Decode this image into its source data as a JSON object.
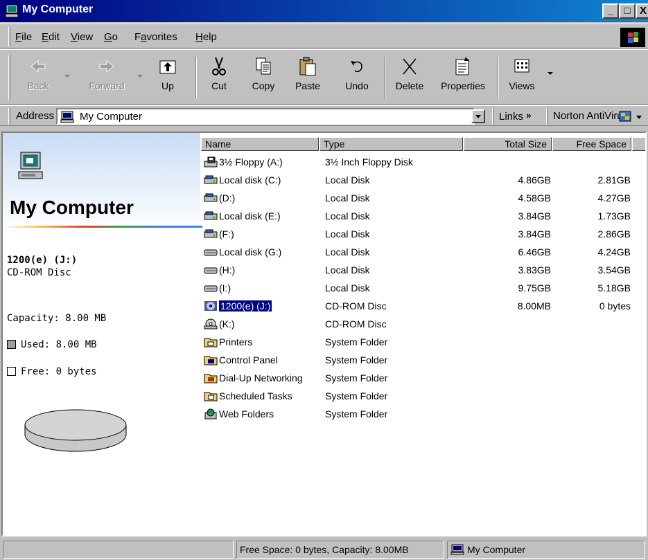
{
  "window": {
    "title": "My Computer",
    "controls": {
      "minimize": "_",
      "maximize": "□",
      "close": "X"
    }
  },
  "menu": [
    "File",
    "Edit",
    "View",
    "Go",
    "Favorites",
    "Help"
  ],
  "menu_accel": [
    "F",
    "E",
    "V",
    "G",
    "a",
    "H"
  ],
  "toolbar": {
    "buttons": [
      {
        "id": "back",
        "label": "Back",
        "icon": "back-arrow-icon",
        "enabled": false,
        "dropdown": true
      },
      {
        "id": "forward",
        "label": "Forward",
        "icon": "forward-arrow-icon",
        "enabled": false,
        "dropdown": true
      },
      {
        "id": "up",
        "label": "Up",
        "icon": "up-folder-icon",
        "enabled": true
      },
      {
        "id": "cut",
        "label": "Cut",
        "icon": "scissors-icon",
        "enabled": true
      },
      {
        "id": "copy",
        "label": "Copy",
        "icon": "copy-icon",
        "enabled": true
      },
      {
        "id": "paste",
        "label": "Paste",
        "icon": "paste-icon",
        "enabled": true
      },
      {
        "id": "undo",
        "label": "Undo",
        "icon": "undo-icon",
        "enabled": true
      },
      {
        "id": "delete",
        "label": "Delete",
        "icon": "delete-x-icon",
        "enabled": true
      },
      {
        "id": "properties",
        "label": "Properties",
        "icon": "properties-icon",
        "enabled": true
      },
      {
        "id": "views",
        "label": "Views",
        "icon": "views-icon",
        "enabled": true,
        "dropdown": true
      }
    ]
  },
  "address": {
    "label": "Address",
    "value": "My Computer",
    "links_label": "Links",
    "links_chevron": "»",
    "norton_label": "Norton AntiVirus"
  },
  "left_pane": {
    "title": "My Computer",
    "drive_name": "1200(e) (J:)",
    "drive_type": "CD-ROM Disc",
    "capacity": "Capacity: 8.00 MB",
    "used": "Used: 8.00 MB",
    "free": "Free: 0 bytes",
    "used_fraction": 1.0
  },
  "list": {
    "columns": [
      "Name",
      "Type",
      "Total Size",
      "Free Space"
    ],
    "rows": [
      {
        "name": "3½ Floppy (A:)",
        "type": "3½ Inch Floppy Disk",
        "total": "",
        "free": "",
        "icon": "floppy-drive-icon"
      },
      {
        "name": "Local disk (C:)",
        "type": "Local Disk",
        "total": "4.86GB",
        "free": "2.81GB",
        "icon": "hard-drive-icon"
      },
      {
        "name": "(D:)",
        "type": "Local Disk",
        "total": "4.58GB",
        "free": "4.27GB",
        "icon": "hard-drive-icon"
      },
      {
        "name": "Local disk (E:)",
        "type": "Local Disk",
        "total": "3.84GB",
        "free": "1.73GB",
        "icon": "hard-drive-icon"
      },
      {
        "name": "(F:)",
        "type": "Local Disk",
        "total": "3.84GB",
        "free": "2.86GB",
        "icon": "hard-drive-icon"
      },
      {
        "name": "Local disk (G:)",
        "type": "Local Disk",
        "total": "6.46GB",
        "free": "4.24GB",
        "icon": "disk-drive-icon"
      },
      {
        "name": "(H:)",
        "type": "Local Disk",
        "total": "3.83GB",
        "free": "3.54GB",
        "icon": "disk-drive-icon"
      },
      {
        "name": "(I:)",
        "type": "Local Disk",
        "total": "9.75GB",
        "free": "5.18GB",
        "icon": "disk-drive-icon"
      },
      {
        "name": "1200(e) (J:)",
        "type": "CD-ROM Disc",
        "total": "8.00MB",
        "free": "0 bytes",
        "icon": "cd-rom-icon",
        "selected": true
      },
      {
        "name": "(K:)",
        "type": "CD-ROM Disc",
        "total": "",
        "free": "",
        "icon": "cd-drive-icon"
      },
      {
        "name": "Printers",
        "type": "System Folder",
        "total": "",
        "free": "",
        "icon": "printers-folder-icon"
      },
      {
        "name": "Control Panel",
        "type": "System Folder",
        "total": "",
        "free": "",
        "icon": "control-panel-icon"
      },
      {
        "name": "Dial-Up Networking",
        "type": "System Folder",
        "total": "",
        "free": "",
        "icon": "dial-up-networking-icon"
      },
      {
        "name": "Scheduled Tasks",
        "type": "System Folder",
        "total": "",
        "free": "",
        "icon": "scheduled-tasks-icon"
      },
      {
        "name": "Web Folders",
        "type": "System Folder",
        "total": "",
        "free": "",
        "icon": "web-folders-icon"
      }
    ]
  },
  "status": {
    "left": "",
    "middle": "Free Space: 0 bytes,  Capacity: 8.00MB",
    "zone": "My Computer"
  },
  "colors": {
    "title_gradient_start": "#000080",
    "title_gradient_end": "#1084d0",
    "selection": "#000080",
    "face": "#c0c0c0"
  }
}
